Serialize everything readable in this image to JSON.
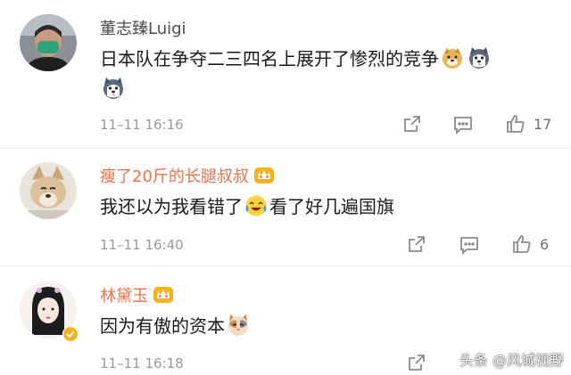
{
  "colors": {
    "name_default": "#4b4b4b",
    "name_vip": "#eb7350",
    "meta": "#9a9a9a",
    "accent_gold": "#f5b21b"
  },
  "comments": [
    {
      "username": "董志臻Luigi",
      "text_before": "日本队在争夺二三四名上展开了惨烈的竞争",
      "text_after": "",
      "emojis": [
        "doge-emoji",
        "husky-emoji",
        "husky-emoji"
      ],
      "time": "11–11 16:16",
      "likes": "17",
      "vip": false
    },
    {
      "username": "瘦了20斤的长腿叔叔",
      "text_before": "我还以为我看错了",
      "text_after": "看了好几遍国旗",
      "emojis": [
        "laugh-cry-emoji"
      ],
      "time": "11–11 16:40",
      "likes": "6",
      "vip": true
    },
    {
      "username": "林黛玉",
      "text_before": "因为有傲的资本",
      "text_after": "",
      "emojis": [
        "cat-emoji"
      ],
      "time": "11–11 16:18",
      "likes": "",
      "vip": true
    }
  ],
  "watermark": "头条 @风城视野"
}
